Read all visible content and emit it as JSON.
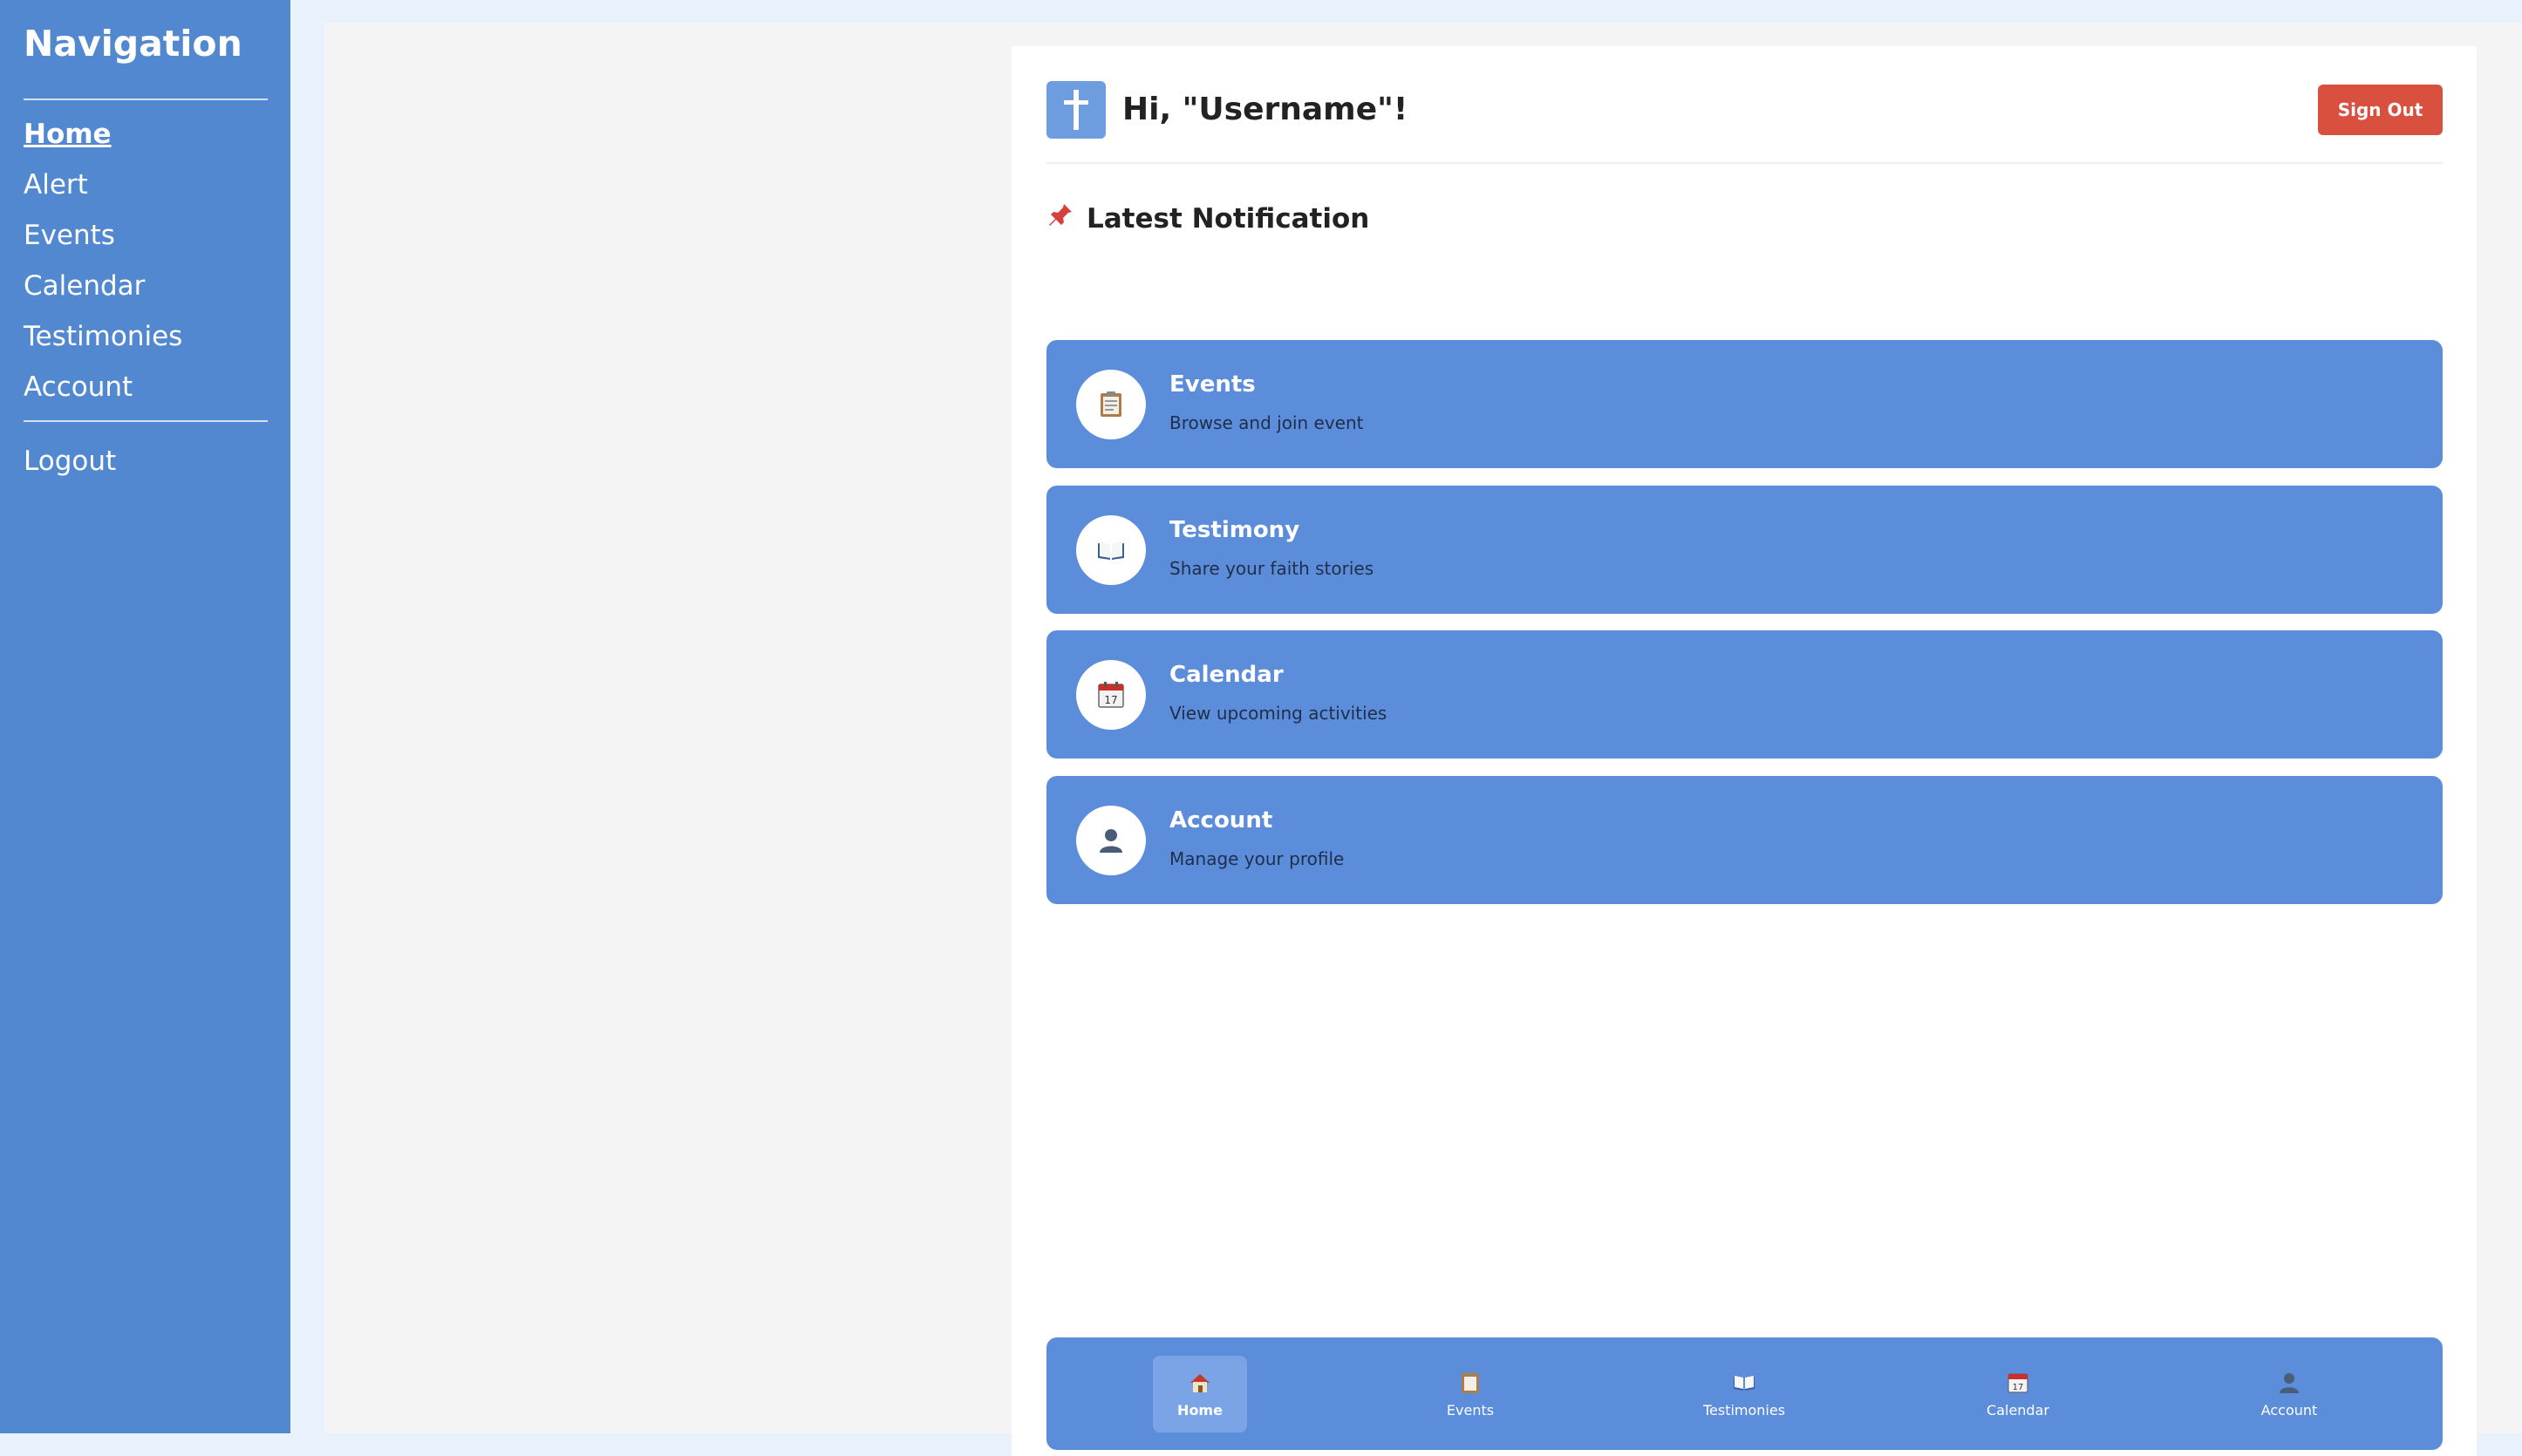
{
  "sidebar": {
    "title": "Navigation",
    "items": [
      {
        "label": "Home",
        "active": true
      },
      {
        "label": "Alert"
      },
      {
        "label": "Events"
      },
      {
        "label": "Calendar"
      },
      {
        "label": "Testimonies"
      },
      {
        "label": "Account"
      }
    ],
    "logout_label": "Logout"
  },
  "header": {
    "logo_icon": "cross-icon",
    "greeting": "Hi, \"Username\"!",
    "signout_label": "Sign Out"
  },
  "notification": {
    "icon": "pushpin-icon",
    "label": "Latest Notification"
  },
  "tiles": [
    {
      "icon": "clipboard-icon",
      "title": "Events",
      "subtitle": "Browse and join event"
    },
    {
      "icon": "open-book-icon",
      "title": "Testimony",
      "subtitle": "Share your faith stories"
    },
    {
      "icon": "calendar-icon",
      "title": "Calendar",
      "subtitle": "View upcoming activities"
    },
    {
      "icon": "user-icon",
      "title": "Account",
      "subtitle": "Manage your profile"
    }
  ],
  "bottom_nav": [
    {
      "icon": "house-icon",
      "label": "Home",
      "active": true
    },
    {
      "icon": "clipboard-icon",
      "label": "Events"
    },
    {
      "icon": "open-book-icon",
      "label": "Testimonies"
    },
    {
      "icon": "calendar-icon",
      "label": "Calendar"
    },
    {
      "icon": "user-icon",
      "label": "Account"
    }
  ],
  "colors": {
    "sidebar_bg": "#5288cf",
    "tile_bg": "#5b8ddb",
    "signout_bg": "#d9503f",
    "page_bg": "#e9f2fc"
  }
}
